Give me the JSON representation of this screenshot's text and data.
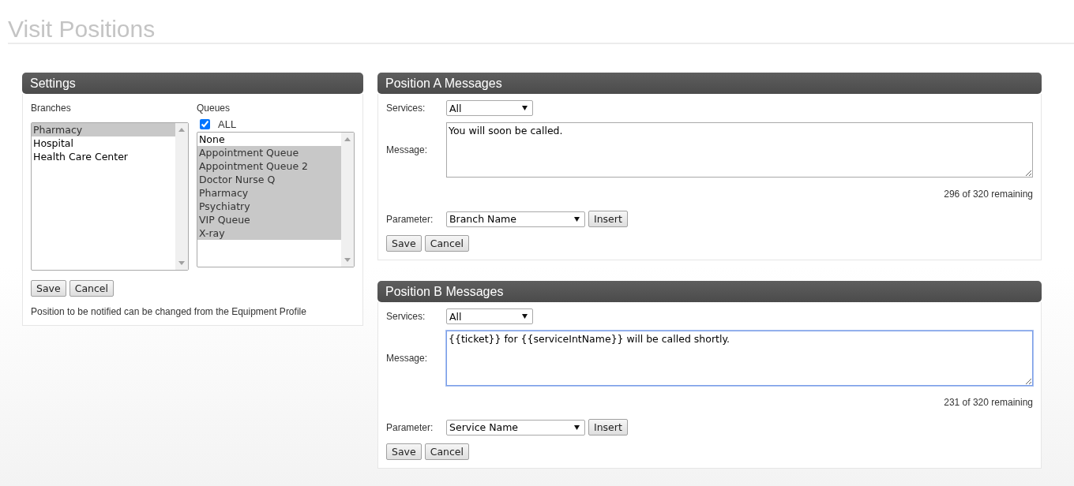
{
  "page_title": "Visit Positions",
  "settings": {
    "title": "Settings",
    "branches_label": "Branches",
    "branches": [
      {
        "label": "Pharmacy",
        "selected": true
      },
      {
        "label": "Hospital",
        "selected": false
      },
      {
        "label": "Health Care Center",
        "selected": false
      }
    ],
    "queues_label": "Queues",
    "all_checkbox": {
      "label": "ALL",
      "checked": true
    },
    "queues": [
      {
        "label": "None",
        "selected": false
      },
      {
        "label": "Appointment Queue",
        "selected": true
      },
      {
        "label": "Appointment Queue 2",
        "selected": true
      },
      {
        "label": "Doctor Nurse Q",
        "selected": true
      },
      {
        "label": "Pharmacy",
        "selected": true
      },
      {
        "label": "Psychiatry",
        "selected": true
      },
      {
        "label": "VIP Queue",
        "selected": true
      },
      {
        "label": "X-ray",
        "selected": true
      }
    ],
    "buttons": [
      "Save",
      "Cancel"
    ],
    "note": "Position to be notified can be changed from the Equipment Profile"
  },
  "positions": [
    {
      "title": "Position A Messages",
      "services_label": "Services:",
      "services_value": "All",
      "message_label": "Message:",
      "message": "You will soon be called.",
      "focused": false,
      "counter": "296 of 320 remaining",
      "parameter_label": "Parameter:",
      "parameter_value": "Branch Name",
      "insert_button": "Insert",
      "buttons": [
        "Save",
        "Cancel"
      ]
    },
    {
      "title": "Position B Messages",
      "services_label": "Services:",
      "services_value": "All",
      "message_label": "Message:",
      "message": "{{ticket}} for {{serviceIntName}} will be called shortly.",
      "focused": true,
      "counter": "231 of 320 remaining",
      "parameter_label": "Parameter:",
      "parameter_value": "Service Name",
      "insert_button": "Insert",
      "buttons": [
        "Save",
        "Cancel"
      ]
    }
  ]
}
